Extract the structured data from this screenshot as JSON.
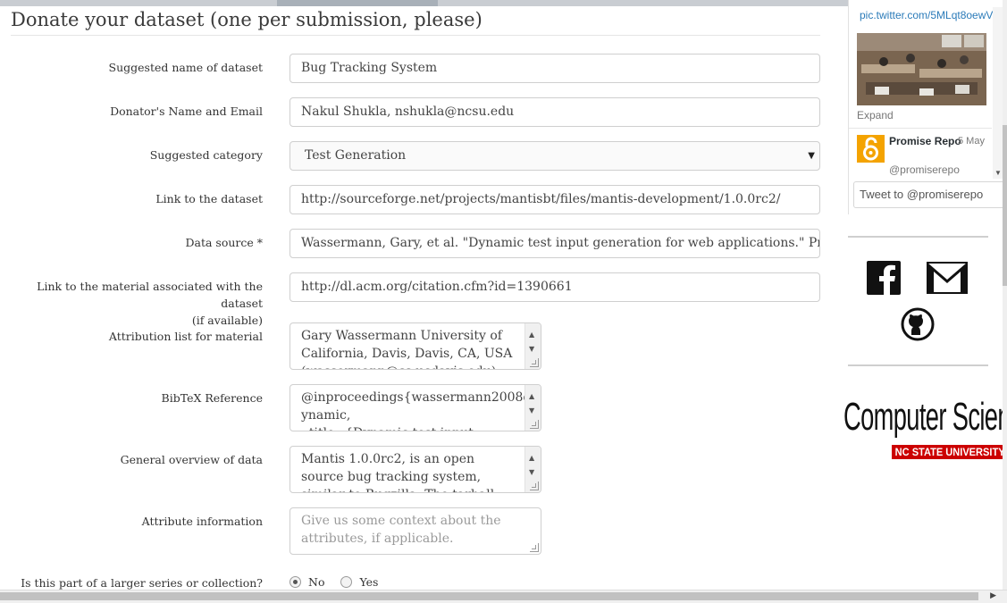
{
  "form": {
    "title": "Donate your dataset (one per submission, please)",
    "fields": [
      {
        "label": "Suggested name of dataset",
        "value": "Bug Tracking System"
      },
      {
        "label": "Donator's Name and Email",
        "value": "Nakul Shukla, nshukla@ncsu.edu"
      },
      {
        "label": "Suggested category",
        "value": "Test Generation"
      },
      {
        "label": "Link to the dataset",
        "value": "http://sourceforge.net/projects/mantisbt/files/mantis-development/1.0.0rc2/"
      },
      {
        "label": "Data source *",
        "value": "Wassermann, Gary, et al. \"Dynamic test input generation for web applications.\" Proce"
      },
      {
        "label_line1": "Link to the material associated with the dataset",
        "label_line2": "(if available)",
        "value": "http://dl.acm.org/citation.cfm?id=1390661"
      }
    ],
    "textareas": [
      {
        "label": "Attribution list for material",
        "text": "Gary Wassermann      University of California, Davis, Davis, CA, USA\n(wassermann@cs.ucdavis.edu)"
      },
      {
        "label": "BibTeX Reference",
        "text": "@inproceedings{wassermann2008d\nynamic,\n  title={Dynamic test input generation"
      },
      {
        "label": "General overview of data",
        "text": "Mantis 1.0.0rc2, is an open source bug tracking system, similar to Bugzilla. The tarball ZIP file for"
      },
      {
        "label": "Attribute information",
        "placeholder": "Give us some context about the attributes, if applicable."
      }
    ],
    "series_question": {
      "label": "Is this part of a larger series or collection?",
      "options": [
        "No",
        "Yes"
      ],
      "selected": "No"
    }
  },
  "twitter": {
    "link": "pic.twitter.com/5MLqt8oewV",
    "expand": "Expand",
    "name": "Promise Repo",
    "date": "5 May",
    "handle": "@promiserepo",
    "tweet_placeholder": "Tweet to @promiserepo"
  },
  "social_icons": [
    "facebook-icon",
    "gmail-icon",
    "github-icon"
  ],
  "logo": {
    "title": "Computer Science",
    "subtitle": "NC STATE UNIVERSITY"
  },
  "colors": {
    "link": "#2b7bb9",
    "ncsu_red": "#cc0000",
    "avatar_orange": "#f4a300"
  }
}
